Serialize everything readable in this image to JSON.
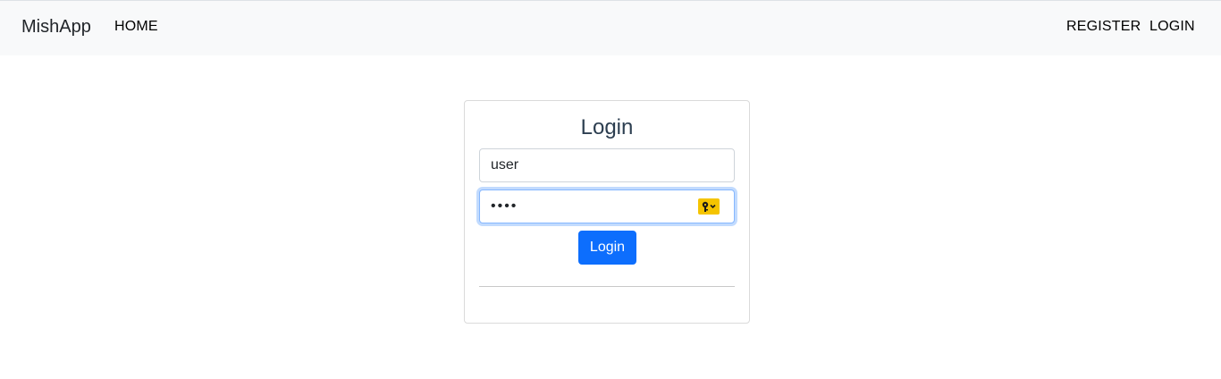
{
  "navbar": {
    "brand": "MishApp",
    "links": {
      "home": "HOME",
      "register": "REGISTER",
      "login": "LOGIN"
    },
    "background": "#f8f9fa"
  },
  "login_card": {
    "title": "Login",
    "username_value": "user",
    "password_value": "••••",
    "password_manager_icon": "key-icon",
    "submit_label": "Login",
    "accent": "#0d6efd",
    "title_color": "#2c3e50"
  }
}
